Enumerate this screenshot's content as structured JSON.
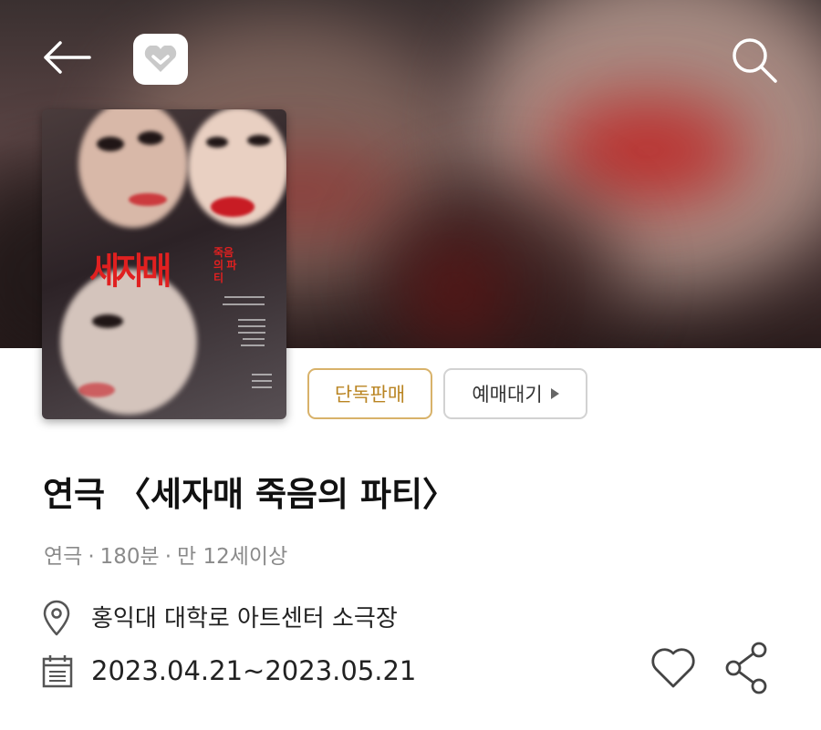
{
  "header": {
    "back_icon": "arrow-left-icon",
    "logo_icon": "heart-logo-icon",
    "search_icon": "search-icon"
  },
  "poster": {
    "title_text": "세자매",
    "subtitle_text": "죽음의 파티"
  },
  "badges": {
    "exclusive_label": "단독판매",
    "wait_label": "예매대기"
  },
  "show": {
    "title": "연극 〈세자매 죽음의 파티〉",
    "genre": "연극",
    "runtime": "180분",
    "age": "만 12세이상",
    "venue": "홍익대 대학로 아트센터 소극장",
    "dates": "2023.04.21~2023.05.21"
  },
  "colors": {
    "exclusive_accent": "#d8b26a",
    "poster_title_red": "#e02020"
  },
  "actions": {
    "like_icon": "heart-outline-icon",
    "share_icon": "share-icon"
  }
}
